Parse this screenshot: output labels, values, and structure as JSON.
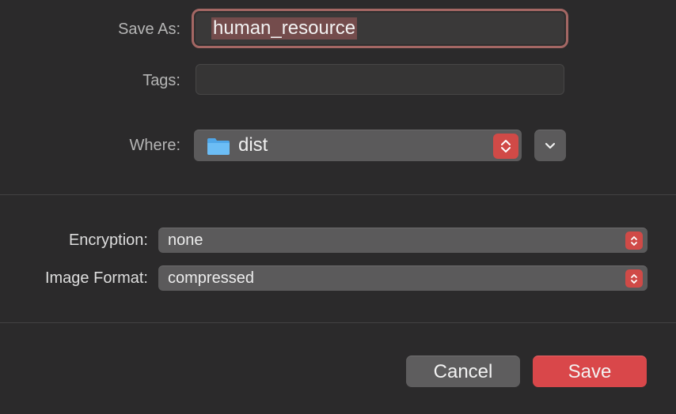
{
  "save_as": {
    "label": "Save As:",
    "value": "human_resource"
  },
  "tags": {
    "label": "Tags:",
    "value": ""
  },
  "where": {
    "label": "Where:",
    "value": "dist"
  },
  "encryption": {
    "label": "Encryption:",
    "value": "none"
  },
  "image_format": {
    "label": "Image Format:",
    "value": "compressed"
  },
  "buttons": {
    "cancel": "Cancel",
    "save": "Save"
  },
  "colors": {
    "accent": "#d9474a",
    "focus_ring": "#a46764",
    "selection": "#744c4c",
    "background": "#2b2a2b"
  },
  "icons": {
    "folder": "folder-icon",
    "stepper": "up-down-chevron-icon",
    "expand": "chevron-down-icon"
  }
}
